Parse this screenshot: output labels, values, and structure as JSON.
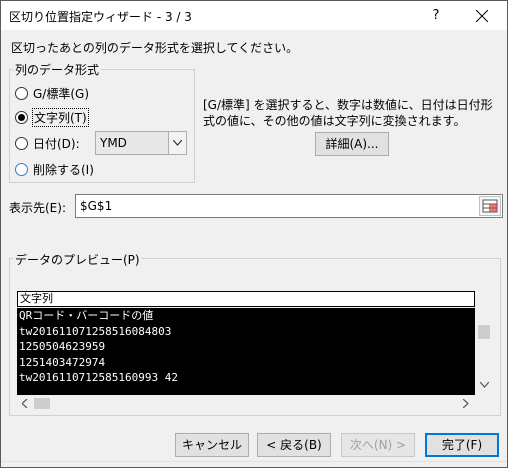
{
  "window": {
    "title": "区切り位置指定ウィザード - 3 / 3",
    "help": "?"
  },
  "instruction": "区切ったあとの列のデータ形式を選択してください。",
  "format_group": {
    "legend": "列のデータ形式",
    "options": [
      {
        "label": "G/標準(G)",
        "checked": false
      },
      {
        "label": "文字列(T)",
        "checked": true
      },
      {
        "label": "日付(D):",
        "checked": false
      },
      {
        "label": "削除する(I)",
        "checked": false
      }
    ],
    "date_select": {
      "value": "YMD"
    }
  },
  "description": "[G/標準] を選択すると、数字は数値に、日付は日付形式の値に、その他の値は文字列に変換されます。",
  "detail_button": "詳細(A)...",
  "destination": {
    "label": "表示先(E):",
    "value": "$G$1"
  },
  "preview": {
    "legend": "データのプレビュー(P)",
    "header": "文字列",
    "rows": [
      "QRコード・バーコードの値",
      "tw20161107125851608480З",
      "1250504623959",
      "1251403472974",
      "tw2016110712585160993 42"
    ]
  },
  "buttons": {
    "cancel": "キャンセル",
    "back": "< 戻る(B)",
    "next": "次へ(N) >",
    "finish": "完了(F)"
  },
  "colors": {
    "accent": "#0078d7",
    "preview_bg": "#000000"
  }
}
